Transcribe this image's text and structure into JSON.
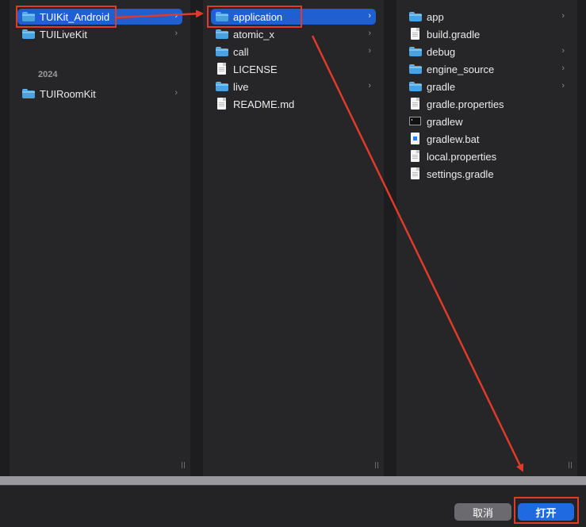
{
  "columns": [
    {
      "items": [
        {
          "label": "TUIKit_Android",
          "type": "folder",
          "selected": true,
          "chevron": "›"
        },
        {
          "label": "TUILiveKit",
          "type": "folder",
          "selected": false,
          "chevron": "›"
        }
      ],
      "section": "2024",
      "section_items": [
        {
          "label": "TUIRoomKit",
          "type": "folder",
          "selected": false,
          "chevron": "›"
        }
      ]
    },
    {
      "items": [
        {
          "label": "application",
          "type": "folder",
          "selected": true,
          "chevron": "›"
        },
        {
          "label": "atomic_x",
          "type": "folder",
          "selected": false,
          "chevron": "›"
        },
        {
          "label": "call",
          "type": "folder",
          "selected": false,
          "chevron": "›"
        },
        {
          "label": "LICENSE",
          "type": "file",
          "selected": false,
          "chevron": ""
        },
        {
          "label": "live",
          "type": "folder",
          "selected": false,
          "chevron": "›"
        },
        {
          "label": "README.md",
          "type": "file",
          "selected": false,
          "chevron": ""
        }
      ]
    },
    {
      "items": [
        {
          "label": "app",
          "type": "folder",
          "chevron": "›"
        },
        {
          "label": "build.gradle",
          "type": "file",
          "chevron": ""
        },
        {
          "label": "debug",
          "type": "folder",
          "chevron": "›"
        },
        {
          "label": "engine_source",
          "type": "folder",
          "chevron": "›"
        },
        {
          "label": "gradle",
          "type": "folder",
          "chevron": "›"
        },
        {
          "label": "gradle.properties",
          "type": "file",
          "chevron": ""
        },
        {
          "label": "gradlew",
          "type": "exec",
          "chevron": ""
        },
        {
          "label": "gradlew.bat",
          "type": "bat",
          "chevron": ""
        },
        {
          "label": "local.properties",
          "type": "file",
          "chevron": ""
        },
        {
          "label": "settings.gradle",
          "type": "file",
          "chevron": ""
        }
      ]
    }
  ],
  "buttons": {
    "cancel": "取消",
    "open": "打开"
  },
  "colors": {
    "selection": "#1f5fd1",
    "annotation": "#e03a2a",
    "primary_button": "#1f6ae0"
  },
  "icons": {
    "folder": "folder-icon",
    "file": "document-icon",
    "exec": "terminal-icon",
    "bat": "batch-file-icon",
    "chevron": "chevron-right-icon"
  }
}
